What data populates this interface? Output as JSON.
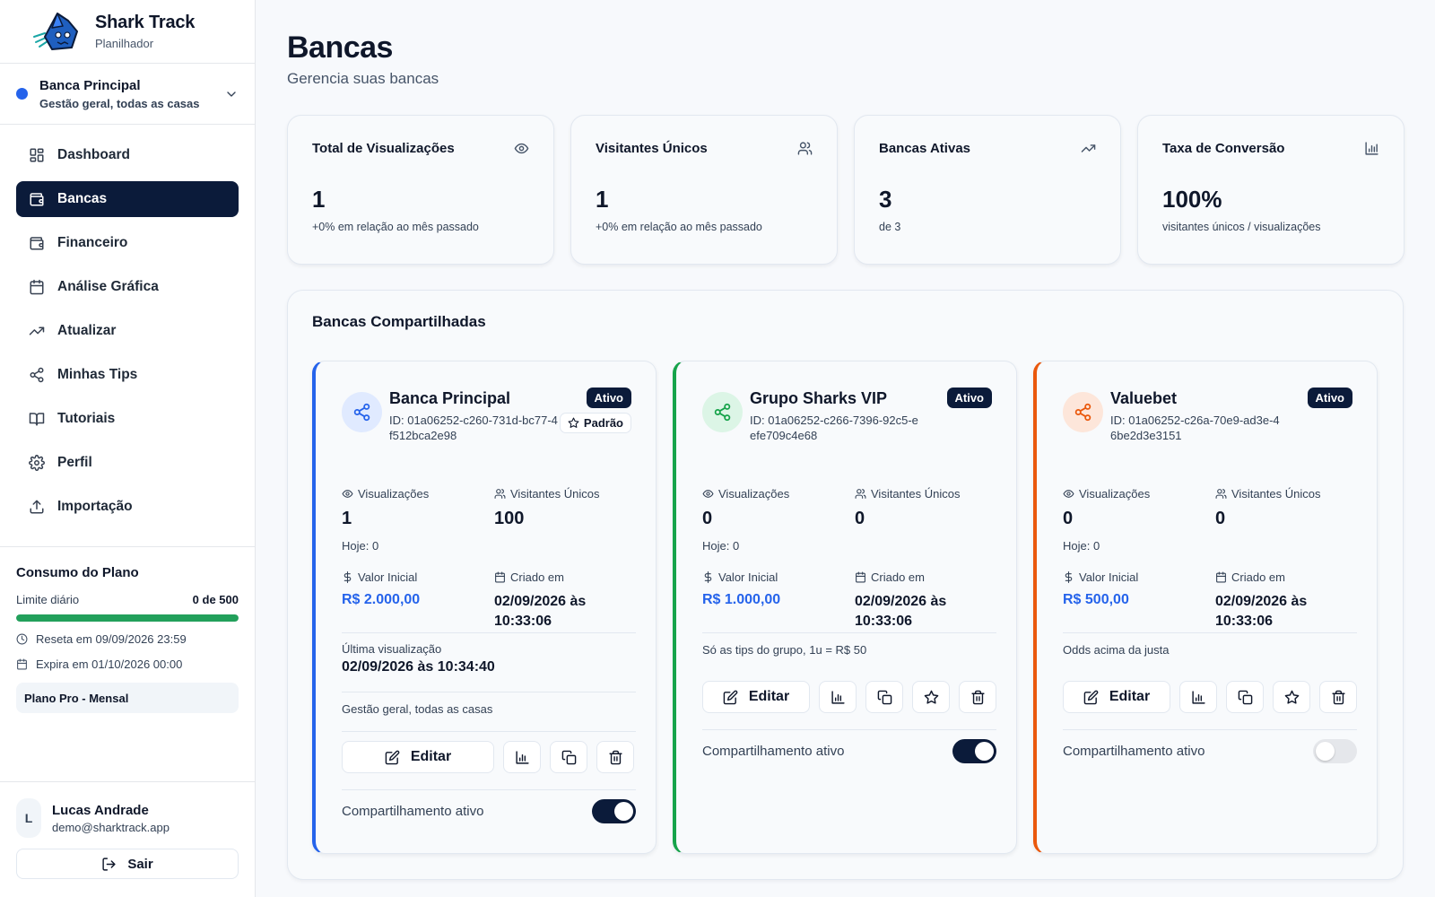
{
  "brand": {
    "name": "Shark Track",
    "subtitle": "Planilhador"
  },
  "bank_selector": {
    "name": "Banca Principal",
    "description": "Gestão geral, todas as casas",
    "dot_color": "#2563eb"
  },
  "nav": {
    "items": [
      {
        "label": "Dashboard",
        "icon": "grid-icon"
      },
      {
        "label": "Bancas",
        "icon": "wallet-icon",
        "active": true
      },
      {
        "label": "Financeiro",
        "icon": "wallet-icon"
      },
      {
        "label": "Análise Gráfica",
        "icon": "calendar-icon"
      },
      {
        "label": "Atualizar",
        "icon": "trending-up-icon"
      },
      {
        "label": "Minhas Tips",
        "icon": "share-icon"
      },
      {
        "label": "Tutoriais",
        "icon": "book-icon"
      },
      {
        "label": "Perfil",
        "icon": "gear-icon"
      },
      {
        "label": "Importação",
        "icon": "upload-icon"
      }
    ]
  },
  "plan": {
    "title": "Consumo do Plano",
    "limit_label": "Limite diário",
    "limit_value": "0 de 500",
    "usage_fraction": 1.0,
    "reset_text": "Reseta em 09/09/2026 23:59",
    "expire_text": "Expira em 01/10/2026 00:00",
    "plan_name": "Plano Pro - Mensal"
  },
  "user": {
    "initial": "L",
    "name": "Lucas Andrade",
    "email": "demo@sharktrack.app",
    "logout_label": "Sair"
  },
  "header": {
    "title": "Bancas",
    "subtitle": "Gerencia suas bancas"
  },
  "stats": [
    {
      "label": "Total de Visualizações",
      "value": "1",
      "note": "+0% em relação ao mês passado",
      "icon": "eye-icon"
    },
    {
      "label": "Visitantes Únicos",
      "value": "1",
      "note": "+0% em relação ao mês passado",
      "icon": "users-icon"
    },
    {
      "label": "Bancas Ativas",
      "value": "3",
      "note": "de 3",
      "icon": "trending-up-icon"
    },
    {
      "label": "Taxa de Conversão",
      "value": "100%",
      "note": "visitantes únicos / visualizações",
      "icon": "bar-chart-icon"
    }
  ],
  "shared": {
    "title": "Bancas Compartilhadas",
    "labels": {
      "views": "Visualizações",
      "unique": "Visitantes Únicos",
      "initial_value": "Valor Inicial",
      "created": "Criado em",
      "last_view": "Última visualização",
      "edit": "Editar",
      "share_active": "Compartilhamento ativo",
      "default": "Padrão",
      "status": "Ativo"
    },
    "cards": [
      {
        "name": "Banca Principal",
        "id": "ID: 01a06252-c260-731d-bc77-4f512bca2e98",
        "views": "1",
        "unique": "100",
        "today": "Hoje: 0",
        "initial_value": "R$ 2.000,00",
        "created": "02/09/2026 às 10:33:06",
        "last_view": "02/09/2026 às 10:34:40",
        "description": "Gestão geral, todas as casas",
        "sharing": true,
        "accent": "#2563eb",
        "icon_bg": "#e0eaff"
      },
      {
        "name": "Grupo Sharks VIP",
        "id": "ID: 01a06252-c266-7396-92c5-eefe709c4e68",
        "views": "0",
        "unique": "0",
        "today": "Hoje: 0",
        "initial_value": "R$ 1.000,00",
        "created": "02/09/2026 às 10:33:06",
        "description": "Só as tips do grupo, 1u = R$ 50",
        "sharing": true,
        "accent": "#16a34a",
        "icon_bg": "#dcf5e6"
      },
      {
        "name": "Valuebet",
        "id": "ID: 01a06252-c26a-70e9-ad3e-46be2d3e3151",
        "views": "0",
        "unique": "0",
        "today": "Hoje: 0",
        "initial_value": "R$ 500,00",
        "created": "02/09/2026 às 10:33:06",
        "description": "Odds acima da justa",
        "sharing": false,
        "accent": "#ea580c",
        "icon_bg": "#fde6da"
      }
    ]
  }
}
